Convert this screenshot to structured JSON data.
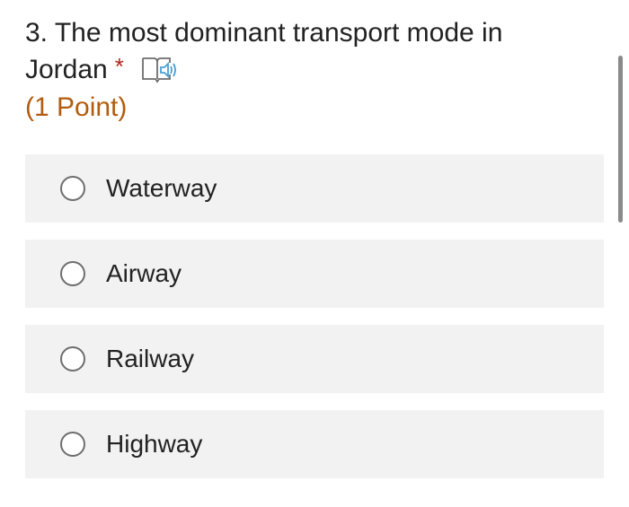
{
  "question": {
    "title": "3. The most dominant transport mode in Jordan",
    "required_mark": "*",
    "points": "(1 Point)",
    "reader_icon": "immersive-reader-icon"
  },
  "options": [
    {
      "label": "Waterway",
      "selected": false
    },
    {
      "label": "Airway",
      "selected": false
    },
    {
      "label": "Railway",
      "selected": false
    },
    {
      "label": "Highway",
      "selected": false
    }
  ],
  "colors": {
    "required": "#b4261a",
    "points": "#b35c0e",
    "option_bg": "#f2f2f2",
    "reader_icon": "#4aa0d4"
  }
}
